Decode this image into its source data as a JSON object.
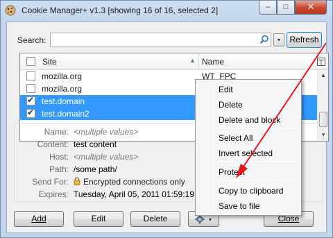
{
  "window": {
    "title": "Cookie Manager+ v1.3 [showing 16 of 16, selected 2]",
    "min_glyph": "–",
    "max_glyph": "□",
    "close_glyph": "✕"
  },
  "search": {
    "label": "Search:",
    "value": "",
    "placeholder": "",
    "dropdown_glyph": "▾",
    "refresh_label": "Refresh"
  },
  "tree": {
    "columns": {
      "site": "Site",
      "name": "Name"
    },
    "sort_glyph": "▲",
    "rows": [
      {
        "site": "mozilla.org",
        "name": "WT_FPC",
        "checked": false,
        "selected": false
      },
      {
        "site": "mozilla.org",
        "name": "",
        "checked": false,
        "selected": false
      },
      {
        "site": "test.domain",
        "name": "",
        "checked": true,
        "selected": true
      },
      {
        "site": "test.domain2",
        "name": "",
        "checked": true,
        "selected": true
      }
    ],
    "scroll_up_glyph": "▲",
    "scroll_down_glyph": "▼"
  },
  "details": {
    "name_label": "Name:",
    "name_value": "<multiple values>",
    "content_label": "Content:",
    "content_value": "test content",
    "host_label": "Host:",
    "host_value": "<multiple values>",
    "path_label": "Path:",
    "path_value": "/some path/",
    "send_for_label": "Send For:",
    "send_for_value": "Encrypted connections only",
    "expires_label": "Expires:",
    "expires_value": "Tuesday, April 05, 2011 01:59:19"
  },
  "buttons": {
    "add": "Add",
    "edit": "Edit",
    "delete": "Delete",
    "gear_arrow": "▾",
    "close": "Close"
  },
  "context_menu": {
    "items": [
      "Edit",
      "Delete",
      "Delete and block",
      "Select All",
      "Invert selected",
      "Protect",
      "Copy to clipboard",
      "Save to file"
    ]
  },
  "colors": {
    "selection": "#3399ff",
    "annotation_arrow": "#e8141c",
    "title_bar": "#c3d6ec"
  }
}
